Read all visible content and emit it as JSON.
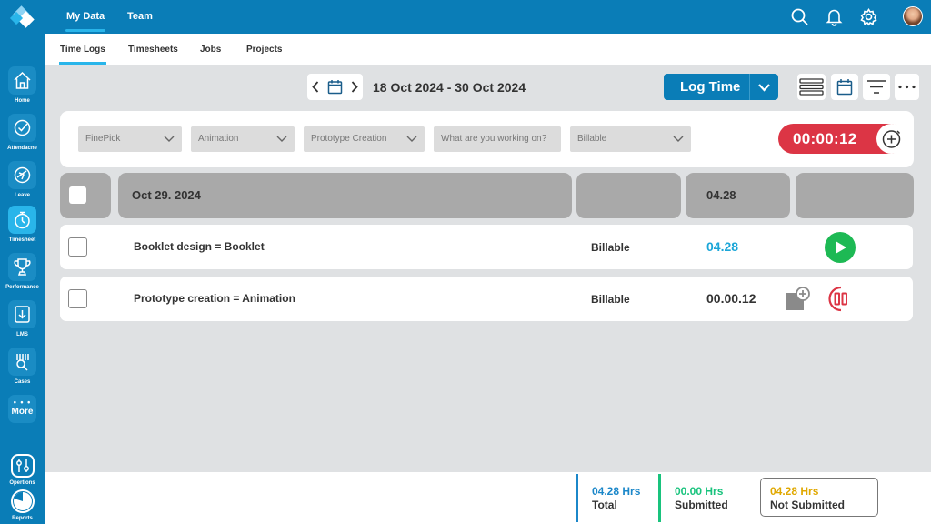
{
  "colors": {
    "brand": "#0a7db7",
    "accent": "#29b5ea",
    "timer": "#dc3545",
    "play": "#1db954",
    "total": "#1b87c9",
    "submitted": "#19c37d",
    "not_submitted": "#e0a800"
  },
  "sidebar": {
    "items": [
      {
        "label": "Home",
        "icon": "home-icon"
      },
      {
        "label": "Attendacne",
        "icon": "attendance-icon"
      },
      {
        "label": "Leave",
        "icon": "leave-icon"
      },
      {
        "label": "Timesheet",
        "icon": "stopwatch-icon"
      },
      {
        "label": "Performance",
        "icon": "trophy-icon"
      },
      {
        "label": "LMS",
        "icon": "download-icon"
      },
      {
        "label": "Cases",
        "icon": "cases-icon"
      }
    ],
    "more_label": "More",
    "bottom": [
      {
        "label": "Opertions",
        "icon": "sliders-icon"
      },
      {
        "label": "Reports",
        "icon": "pie-chart-icon"
      }
    ]
  },
  "topbar": {
    "tabs": [
      "My Data",
      "Team"
    ]
  },
  "subtabs": [
    "Time Logs",
    "Timesheets",
    "Jobs",
    "Projects"
  ],
  "toolbar": {
    "date_range": "18 Oct 2024 - 30 Oct 2024",
    "log_time_label": "Log Time"
  },
  "filters": {
    "client": "FinePick",
    "category": "Animation",
    "task": "Prototype Creation",
    "description_placeholder": "What are you working on?",
    "billing": "Billable",
    "timer": "00:00:12"
  },
  "group": {
    "date": "Oct 29. 2024",
    "hours": "04.28"
  },
  "rows": [
    {
      "title": "Booklet design = Booklet",
      "billing": "Billable",
      "hours": "04.28",
      "state": "stopped"
    },
    {
      "title": "Prototype creation = Animation",
      "billing": "Billable",
      "hours": "00.00.12",
      "state": "running"
    }
  ],
  "footer": {
    "total_value": "04.28 Hrs",
    "total_label": "Total",
    "submitted_value": "00.00 Hrs",
    "submitted_label": "Submitted",
    "not_submitted_value": "04.28 Hrs",
    "not_submitted_label": "Not Submitted"
  }
}
